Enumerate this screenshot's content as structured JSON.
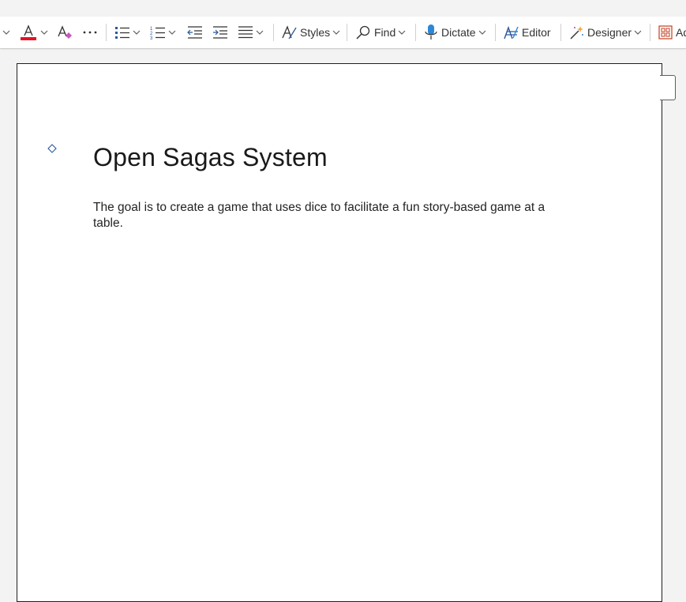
{
  "toolbar": {
    "items": [
      {
        "name": "font-color",
        "icon": "font-color-icon",
        "accent": "#e81123"
      },
      {
        "name": "clear-formatting",
        "icon": "clear-formatting-icon"
      },
      {
        "name": "more",
        "icon": "more-icon"
      },
      {
        "name": "bullets",
        "icon": "bullets-icon"
      },
      {
        "name": "numbering",
        "icon": "numbering-icon"
      },
      {
        "name": "decrease-indent",
        "icon": "decrease-indent-icon"
      },
      {
        "name": "increase-indent",
        "icon": "increase-indent-icon"
      },
      {
        "name": "align",
        "icon": "align-icon"
      }
    ],
    "styles_label": "Styles",
    "find_label": "Find",
    "dictate_label": "Dictate",
    "editor_label": "Editor",
    "designer_label": "Designer",
    "addins_label": "Ad"
  },
  "document": {
    "title": "Open Sagas System",
    "body": "The goal is to create a game that uses dice to facilitate a fun story-based game at a table."
  },
  "colors": {
    "accent_blue": "#2b579a",
    "font_color_red": "#e81123",
    "canvas": "#f3f3f3"
  }
}
